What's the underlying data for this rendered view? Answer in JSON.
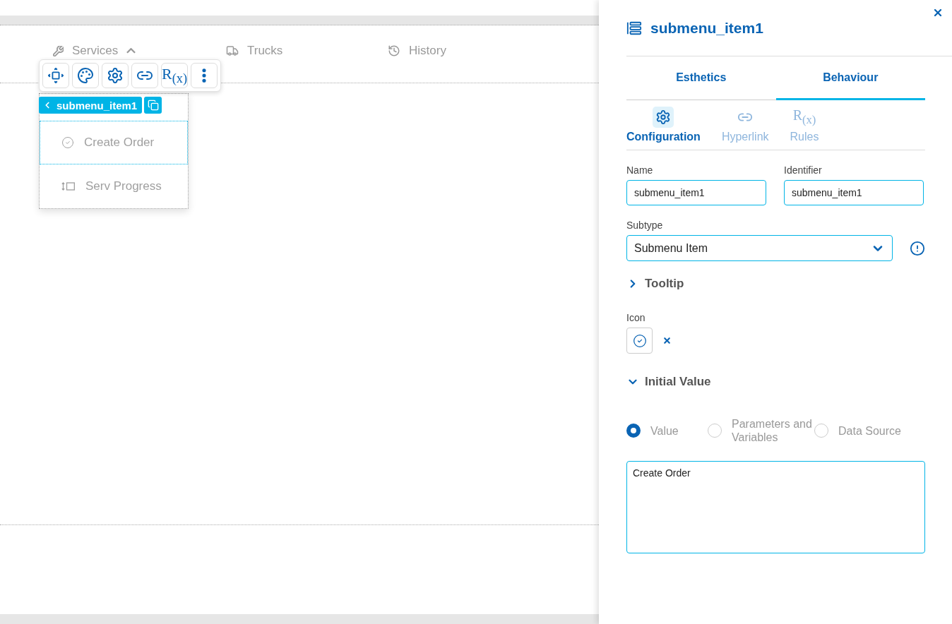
{
  "canvas": {
    "nav_items": [
      {
        "label": "Services",
        "expanded": true
      },
      {
        "label": "Trucks"
      },
      {
        "label": "History"
      }
    ],
    "toolbar_buttons": [
      {
        "kind": "move"
      },
      {
        "kind": "palette"
      },
      {
        "kind": "gear"
      },
      {
        "kind": "link"
      },
      {
        "kind": "formula",
        "label": "R$_{(x)}$"
      },
      {
        "kind": "more"
      }
    ],
    "selection_chip": {
      "label": "submenu_item1"
    },
    "submenu_items": [
      {
        "label": "Create Order",
        "selected": true
      },
      {
        "label": "Serv Progress",
        "selected": false
      }
    ]
  },
  "panel": {
    "title": "submenu_item1",
    "tabs": [
      {
        "label": "Esthetics",
        "selected": false
      },
      {
        "label": "Behaviour",
        "selected": true
      }
    ],
    "subtabs": [
      {
        "kind": "gear",
        "label": "Configuration",
        "selected": true
      },
      {
        "kind": "link",
        "label": "Hyperlink",
        "selected": false
      },
      {
        "kind": "formula",
        "label": "Rules",
        "icon_text": "R$_{(x)}$",
        "selected": false
      }
    ],
    "name": {
      "label": "Name",
      "value": "submenu_item1"
    },
    "identifier": {
      "label": "Identifier",
      "value": "submenu_item1"
    },
    "subtype": {
      "label": "Subtype",
      "value": "Submenu Item"
    },
    "tooltip": {
      "label": "Tooltip",
      "expanded": false
    },
    "icon": {
      "label": "Icon"
    },
    "initial_value": {
      "label": "Initial Value",
      "expanded": true,
      "options": [
        {
          "label": "Value",
          "selected": true
        },
        {
          "label": "Parameters and Variables",
          "selected": false
        },
        {
          "label": "Data Source",
          "selected": false
        }
      ],
      "value": "Create Order"
    }
  }
}
